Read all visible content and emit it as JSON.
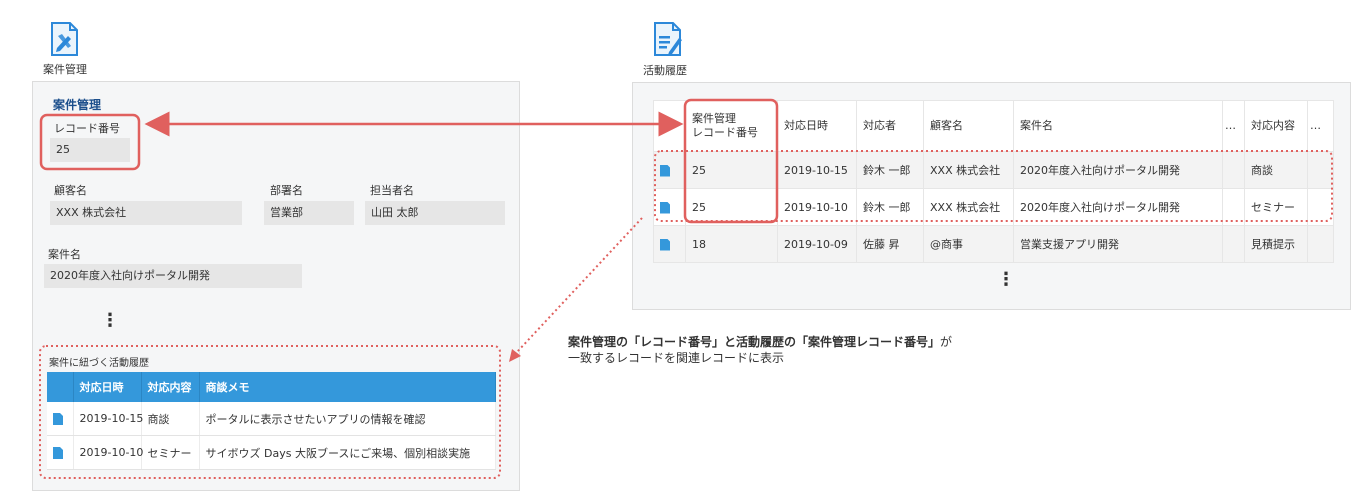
{
  "left_app": {
    "icon": "project-management-icon",
    "label": "案件管理"
  },
  "right_app": {
    "icon": "activity-history-icon",
    "label": "活動履歴"
  },
  "record_form": {
    "title": "案件管理",
    "record_number_label": "レコード番号",
    "record_number_value": "25",
    "customer_label": "顧客名",
    "customer_value": "XXX 株式会社",
    "department_label": "部署名",
    "department_value": "営業部",
    "contact_label": "担当者名",
    "contact_value": "山田 太郎",
    "project_label": "案件名",
    "project_value": "2020年度入社向けポータル開発",
    "more_indicator": "⋮",
    "related": {
      "title": "案件に紐づく活動履歴",
      "headers": [
        "対応日時",
        "対応内容",
        "商談メモ"
      ],
      "rows": [
        {
          "icon": "document-icon",
          "date": "2019-10-15",
          "type": "商談",
          "memo": "ポータルに表示させたいアプリの情報を確認"
        },
        {
          "icon": "document-icon",
          "date": "2019-10-10",
          "type": "セミナー",
          "memo": "サイボウズ Days 大阪ブースにご来場、個別相談実施"
        }
      ]
    }
  },
  "activity_list": {
    "headers": {
      "record_no_line1": "案件管理",
      "record_no_line2": "レコード番号",
      "date": "対応日時",
      "handler": "対応者",
      "customer": "顧客名",
      "project": "案件名",
      "ellipsis1": "…",
      "content": "対応内容",
      "ellipsis2": "…"
    },
    "rows": [
      {
        "icon": "document-icon",
        "record_no": "25",
        "date": "2019-10-15",
        "handler": "鈴木 一郎",
        "customer": "XXX 株式会社",
        "project": "2020年度入社向けポータル開発",
        "content": "商談"
      },
      {
        "icon": "document-icon",
        "record_no": "25",
        "date": "2019-10-10",
        "handler": "鈴木 一郎",
        "customer": "XXX 株式会社",
        "project": "2020年度入社向けポータル開発",
        "content": "セミナー"
      },
      {
        "icon": "document-icon",
        "record_no": "18",
        "date": "2019-10-09",
        "handler": "佐藤 昇",
        "customer": "@商事",
        "project": "営業支援アプリ開発",
        "content": "見積提示"
      }
    ],
    "more_indicator": "⋮"
  },
  "callout": {
    "part1": "案件管理の「レコード番号」と活動履歴の「案件管理レコード番号」",
    "part2": "が",
    "line2": "一致するレコードを関連レコードに表示"
  },
  "colors": {
    "annotation_red": "#e0605e",
    "header_blue": "#3498db",
    "title_navy": "#1c4f8c"
  }
}
